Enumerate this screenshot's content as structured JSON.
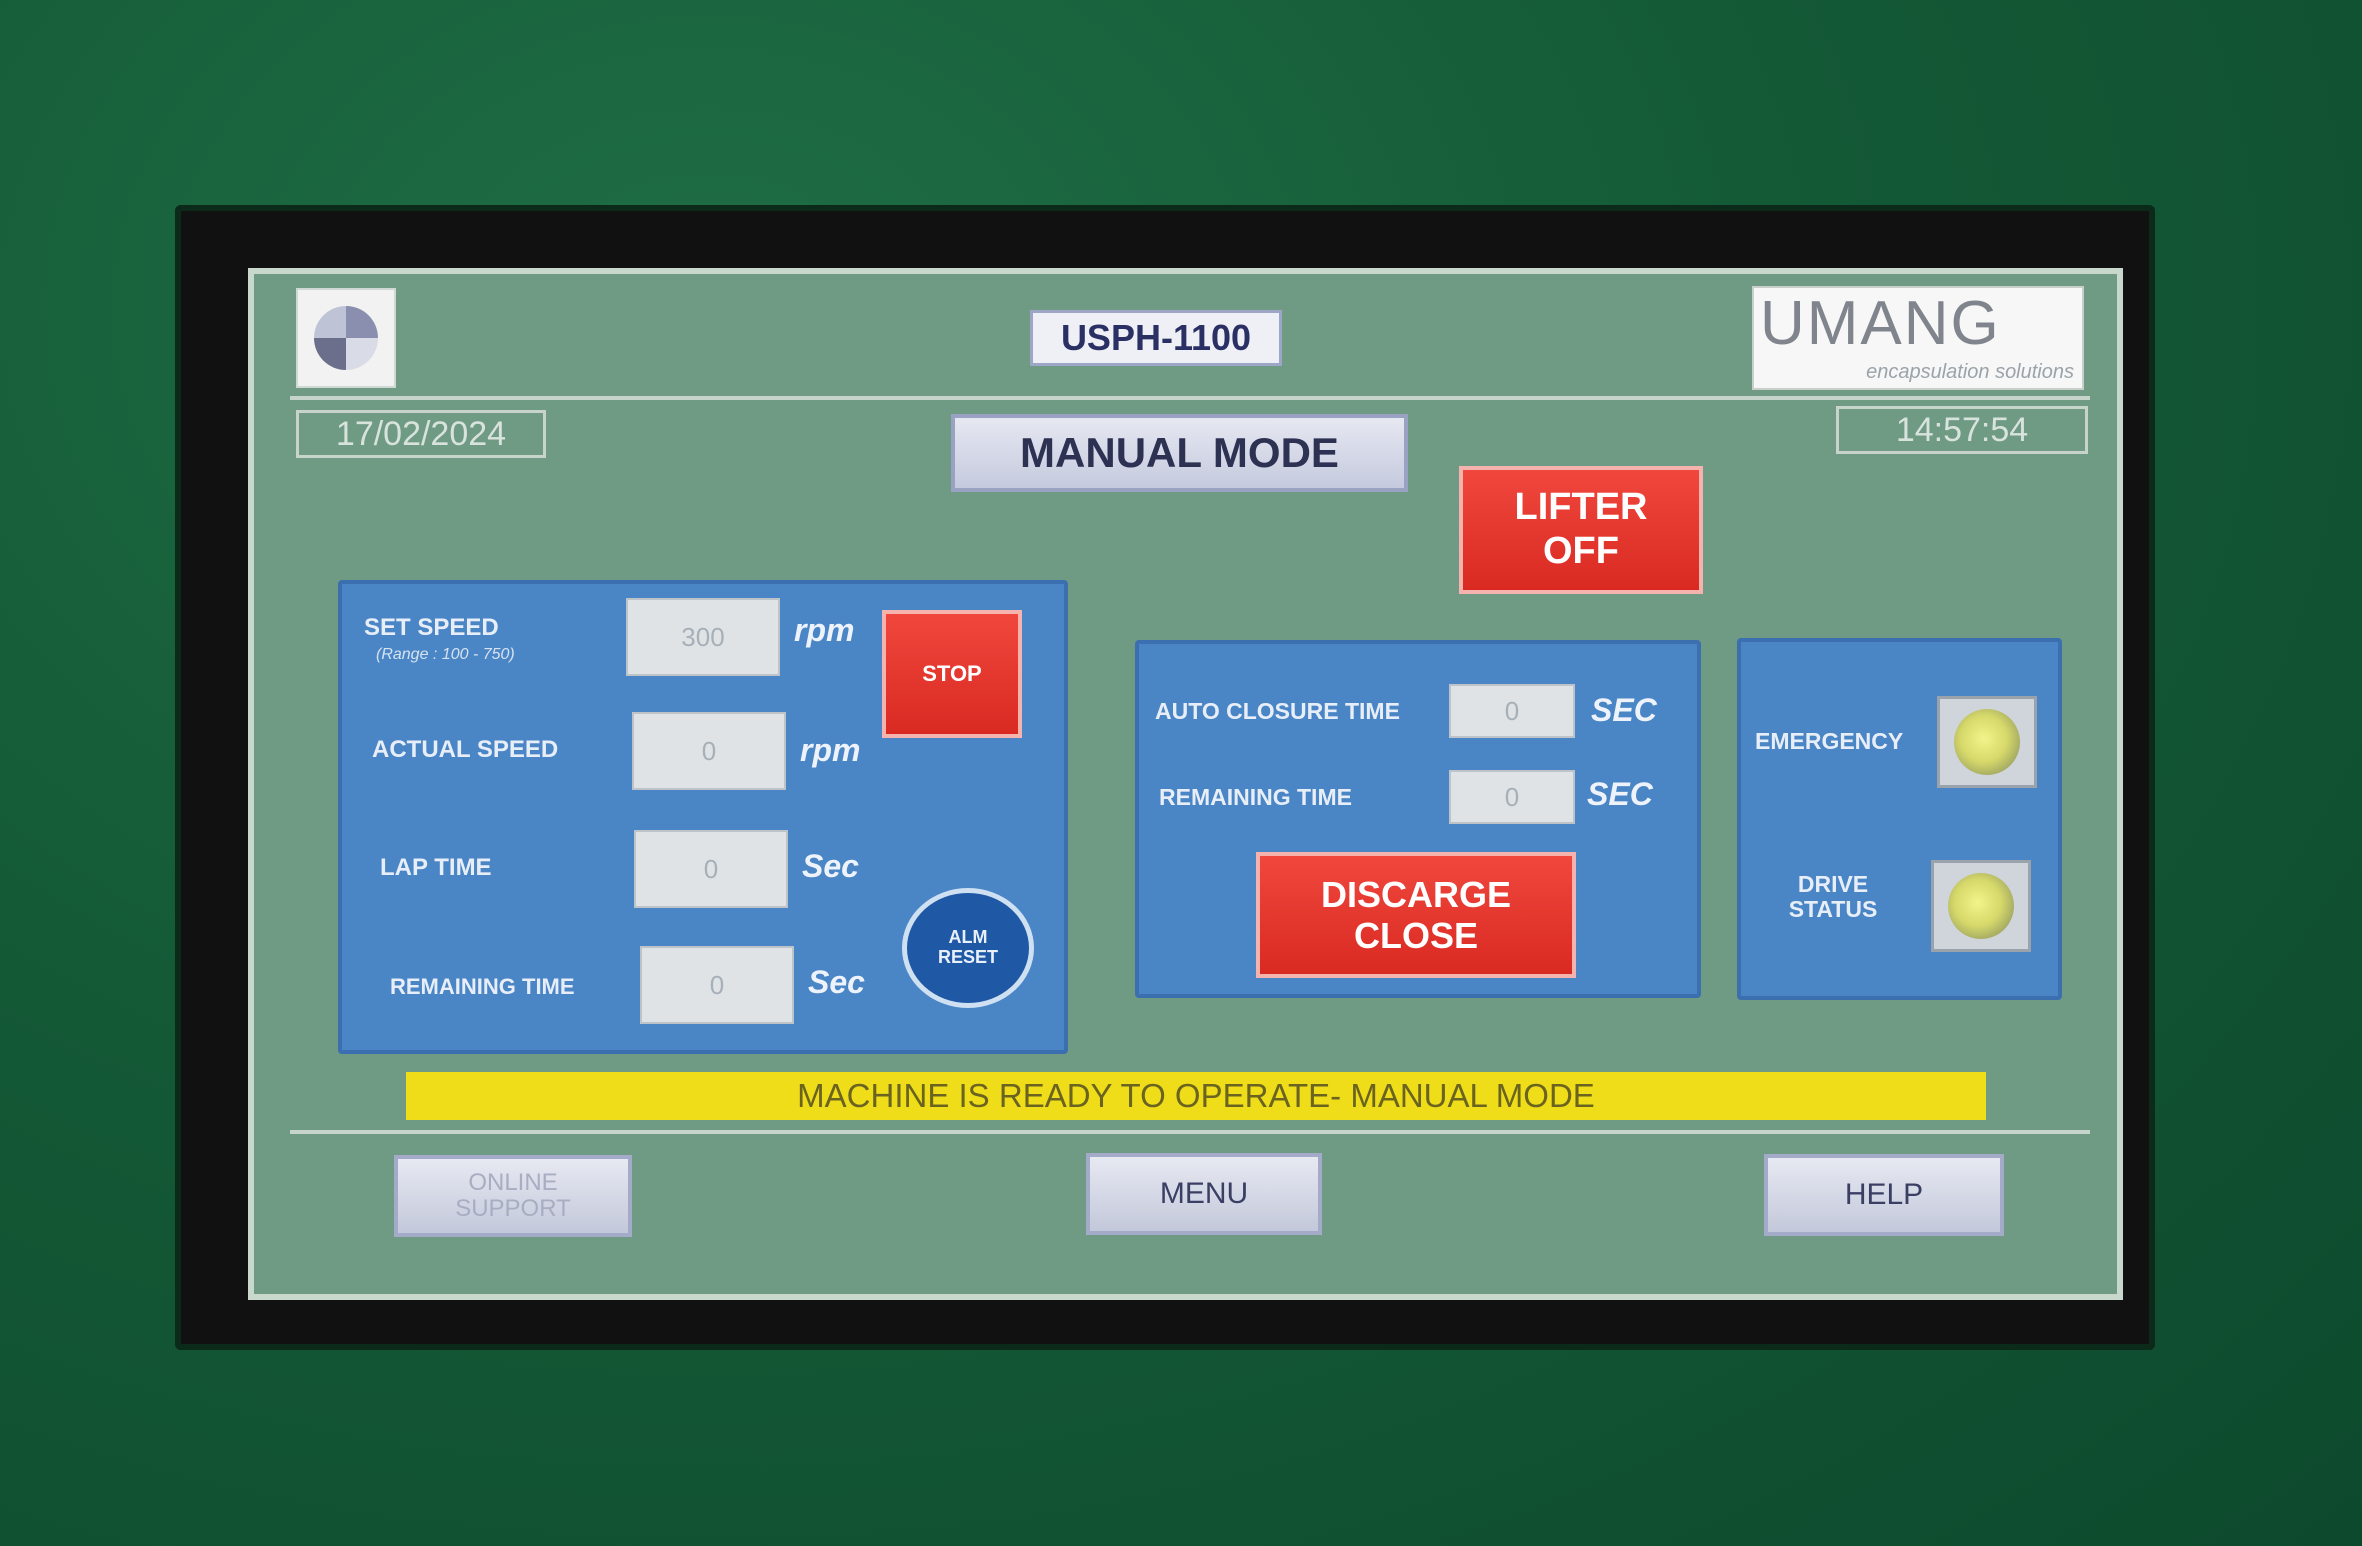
{
  "header": {
    "model": "USPH-1100",
    "brand_name": "UMANG",
    "brand_tagline": "encapsulation solutions",
    "date": "17/02/2024",
    "time": "14:57:54",
    "mode_title": "MANUAL MODE"
  },
  "lifter_button": {
    "line1": "LIFTER",
    "line2": "OFF"
  },
  "speed_panel": {
    "set_speed_label": "SET SPEED",
    "set_speed_range": "(Range : 100 - 750)",
    "set_speed_value": "300",
    "set_speed_unit": "rpm",
    "actual_speed_label": "ACTUAL SPEED",
    "actual_speed_value": "0",
    "actual_speed_unit": "rpm",
    "lap_time_label": "LAP TIME",
    "lap_time_value": "0",
    "lap_time_unit": "Sec",
    "remaining_time_label": "REMAINING TIME",
    "remaining_time_value": "0",
    "remaining_time_unit": "Sec",
    "stop_label": "STOP",
    "alm_reset_line1": "ALM",
    "alm_reset_line2": "RESET"
  },
  "closure_panel": {
    "auto_closure_label": "AUTO CLOSURE TIME",
    "auto_closure_value": "0",
    "auto_closure_unit": "SEC",
    "remaining_label": "REMAINING TIME",
    "remaining_value": "0",
    "remaining_unit": "SEC",
    "discarge_line1": "DISCARGE",
    "discarge_line2": "CLOSE"
  },
  "status_panel": {
    "emergency_label": "EMERGENCY",
    "drive_status_line1": "DRIVE",
    "drive_status_line2": "STATUS"
  },
  "status_message": "MACHINE IS READY TO OPERATE- MANUAL MODE",
  "footer": {
    "online_support_line1": "ONLINE",
    "online_support_line2": "SUPPORT",
    "menu": "MENU",
    "help": "HELP"
  },
  "colors": {
    "screen_bg": "#6f9a84",
    "panel_blue": "#4a86c6",
    "alarm_red": "#e0352c",
    "status_yellow": "#f0dd1a",
    "lamp_yellow": "#e0e27a"
  }
}
